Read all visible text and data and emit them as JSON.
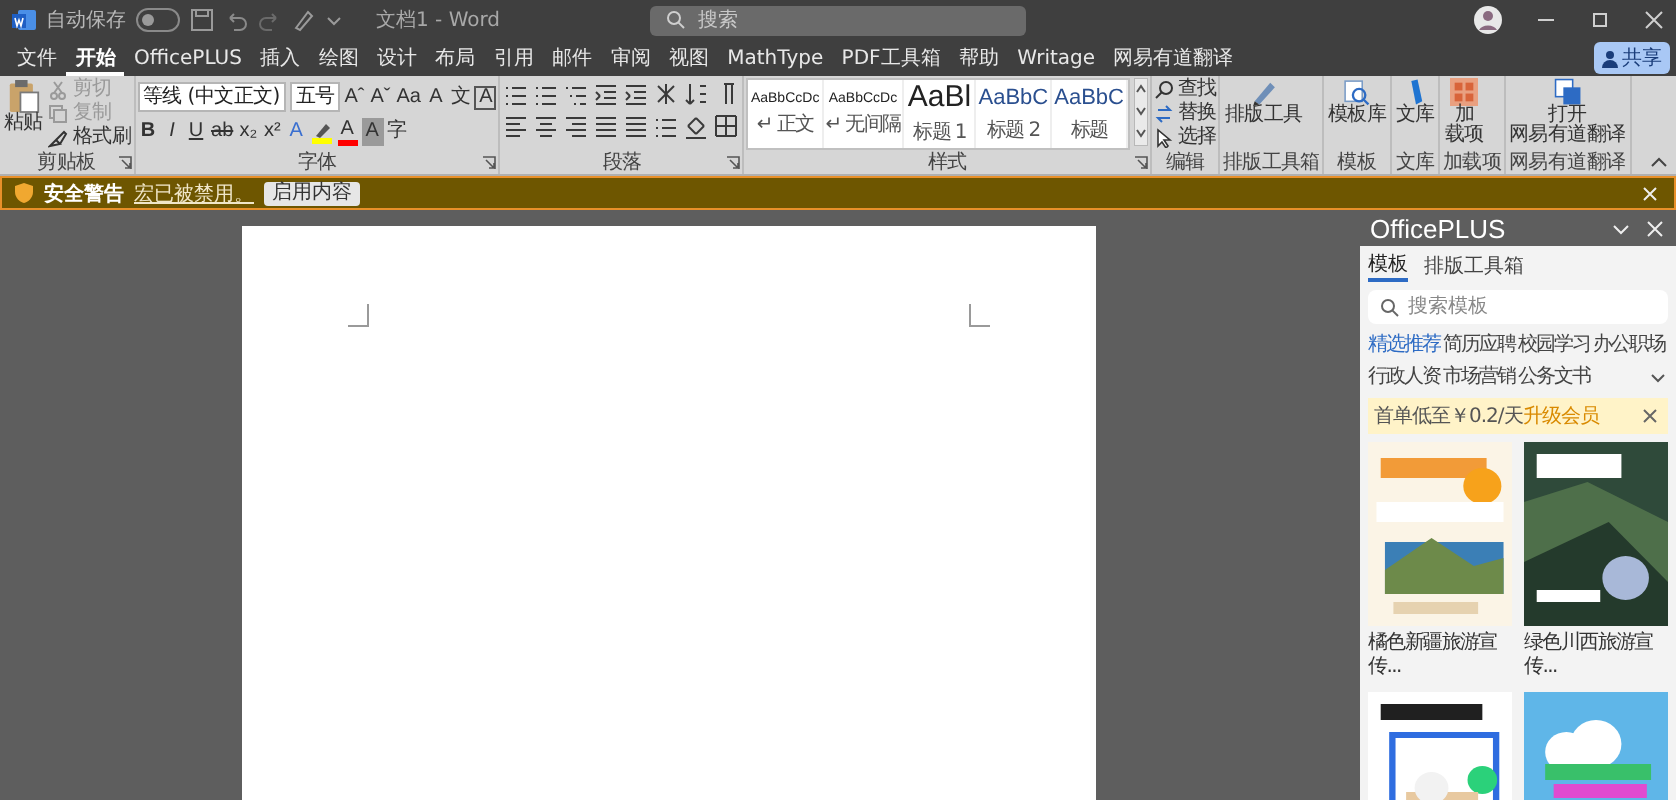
{
  "titlebar": {
    "autosave_label": "自动保存",
    "autosave_on": false,
    "title": "文档1 - Word",
    "search_placeholder": "搜索"
  },
  "tabs": [
    {
      "label": "文件",
      "selected": false
    },
    {
      "label": "开始",
      "selected": true
    },
    {
      "label": "OfficePLUS",
      "selected": false
    },
    {
      "label": "插入",
      "selected": false
    },
    {
      "label": "绘图",
      "selected": false
    },
    {
      "label": "设计",
      "selected": false
    },
    {
      "label": "布局",
      "selected": false
    },
    {
      "label": "引用",
      "selected": false
    },
    {
      "label": "邮件",
      "selected": false
    },
    {
      "label": "审阅",
      "selected": false
    },
    {
      "label": "视图",
      "selected": false
    },
    {
      "label": "MathType",
      "selected": false
    },
    {
      "label": "PDF工具箱",
      "selected": false
    },
    {
      "label": "帮助",
      "selected": false
    },
    {
      "label": "Writage",
      "selected": false
    },
    {
      "label": "网易有道翻译",
      "selected": false
    }
  ],
  "share_button": "共享",
  "ribbon": [
    {
      "kind": "clipboard",
      "name": "剪贴板",
      "launcher": true,
      "paste": "粘贴",
      "items": [
        {
          "kind": "cut",
          "label": "剪切",
          "disabled": true
        },
        {
          "kind": "copy",
          "label": "复制",
          "disabled": true
        },
        {
          "kind": "brush",
          "label": "格式刷",
          "disabled": false
        }
      ]
    },
    {
      "kind": "font",
      "name": "字体",
      "launcher": true,
      "font_name": "等线 (中文正文)",
      "font_size": "五号",
      "row1": [
        {
          "kind": "grow",
          "glyph": "Aˆ"
        },
        {
          "kind": "shrink",
          "glyph": "Aˇ"
        },
        {
          "kind": "case",
          "glyph": "Aa"
        },
        {
          "kind": "clear",
          "glyph": "A"
        },
        {
          "kind": "phonetic",
          "glyph": "文"
        },
        {
          "kind": "border",
          "glyph": "A"
        }
      ],
      "row2": [
        {
          "kind": "bold",
          "glyph": "B"
        },
        {
          "kind": "italic",
          "glyph": "I"
        },
        {
          "kind": "underline",
          "glyph": "U"
        },
        {
          "kind": "strike",
          "glyph": "ab"
        },
        {
          "kind": "sub",
          "glyph": "x₂"
        },
        {
          "kind": "sup",
          "glyph": "x²"
        },
        {
          "kind": "effect",
          "glyph": "A"
        },
        {
          "kind": "highlight",
          "color": "#ffff00"
        },
        {
          "kind": "color",
          "glyph": "A",
          "color": "#ff0000"
        },
        {
          "kind": "shade",
          "glyph": "A"
        },
        {
          "kind": "enclose",
          "glyph": "字"
        }
      ]
    },
    {
      "kind": "paragraph",
      "name": "段落",
      "launcher": true
    },
    {
      "kind": "styles",
      "name": "样式",
      "launcher": true,
      "styles": [
        {
          "kind": "body",
          "preview": "AaBbCcDc",
          "label": "↵ 正文"
        },
        {
          "kind": "body",
          "preview": "AaBbCcDc",
          "label": "↵ 无间隔"
        },
        {
          "kind": "heading1",
          "preview": "AaBl",
          "label": "标题 1"
        },
        {
          "kind": "heading2",
          "preview": "AaBbC",
          "label": "标题 2"
        },
        {
          "kind": "heading2",
          "preview": "AaBbC",
          "label": "标题"
        }
      ]
    },
    {
      "kind": "editing",
      "name": "编辑",
      "items": [
        {
          "kind": "find",
          "label": "查找"
        },
        {
          "kind": "replace",
          "label": "替换"
        },
        {
          "kind": "select",
          "label": "选择"
        }
      ]
    },
    {
      "kind": "large",
      "name": "排版工具箱",
      "lines": [
        "排版工具"
      ]
    },
    {
      "kind": "large",
      "name": "模板",
      "lines": [
        "模板库"
      ]
    },
    {
      "kind": "large",
      "name": "文库",
      "lines": [
        "文库"
      ]
    },
    {
      "kind": "large",
      "name": "加载项",
      "lines": [
        "加",
        "载项"
      ]
    },
    {
      "kind": "large",
      "name": "网易有道翻译",
      "lines": [
        "打开",
        "网易有道翻译"
      ]
    }
  ],
  "security_bar": {
    "title": "安全警告",
    "message": "宏已被禁用。",
    "button": "启用内容"
  },
  "pane": {
    "title": "OfficePLUS",
    "tabs": [
      {
        "label": "模板",
        "selected": true
      },
      {
        "label": "排版工具箱",
        "selected": false
      }
    ],
    "search_placeholder": "搜索模板",
    "categories": [
      {
        "label": "精选推荐",
        "selected": true
      },
      {
        "label": "简历应聘",
        "selected": false
      },
      {
        "label": "校园学习",
        "selected": false
      },
      {
        "label": "办公职场",
        "selected": false
      },
      {
        "label": "行政人资",
        "selected": false
      },
      {
        "label": "市场营销",
        "selected": false
      },
      {
        "label": "公务文书",
        "selected": false
      }
    ],
    "promo": {
      "text": "首单低至￥0.2/天",
      "link": "升级会员"
    },
    "templates": [
      {
        "kind": "picture",
        "title": "橘色新疆旅游宣传..."
      },
      {
        "kind": "picture",
        "title": "绿色川西旅游宣传..."
      },
      {
        "kind": "picture"
      },
      {
        "kind": "picture"
      }
    ]
  }
}
